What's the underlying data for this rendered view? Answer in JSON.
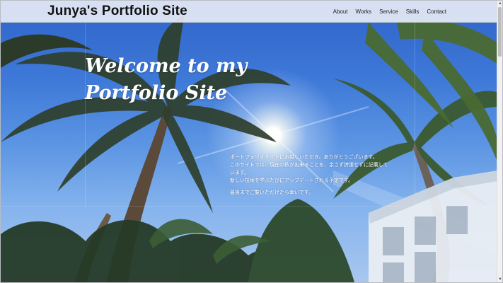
{
  "header": {
    "site_title": "Junya's Portfolio Site",
    "nav": [
      {
        "label": "About"
      },
      {
        "label": "Works"
      },
      {
        "label": "Service"
      },
      {
        "label": "Skills"
      },
      {
        "label": "Contact"
      }
    ]
  },
  "hero": {
    "headline_line1": "Welcome to my",
    "headline_line2": "Portfolio Site",
    "intro_lines": [
      "ポートフォリオサイトにお越しいただき、ありがとうございます。",
      "このサイトでは、現在の私が出来ることを、余さず誇張せずに記載しています。",
      "新しい技術を学ぶたびにアップデートされる予定です。",
      "最後までご覧いただけたら幸いです。"
    ]
  },
  "colors": {
    "sky_top": "#2f63c9",
    "sky_bottom": "#a8c7ef",
    "header_bg": "#eef1f7",
    "text_light": "#ffffff",
    "text_dark": "#111111"
  }
}
